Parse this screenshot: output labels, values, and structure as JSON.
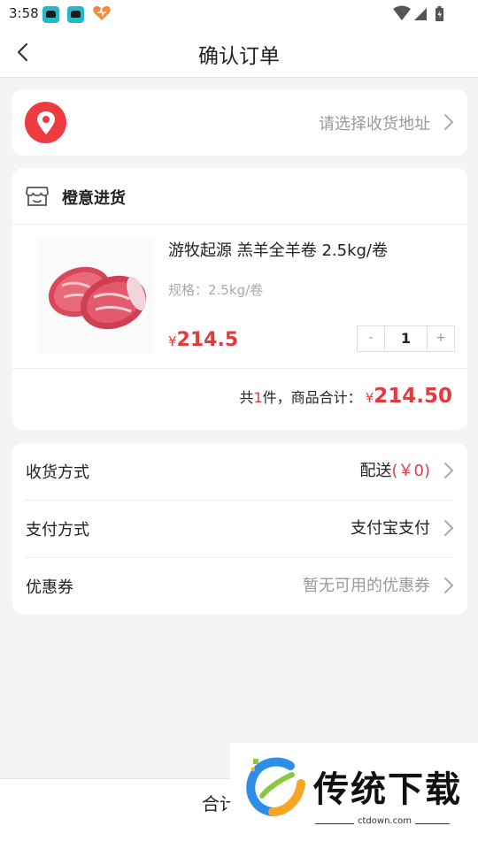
{
  "status_bar": {
    "time": "3:58",
    "icons": [
      "car-app-icon",
      "car-app-icon",
      "heart-app-icon",
      "wifi-icon",
      "signal-icon",
      "battery-icon"
    ]
  },
  "navbar": {
    "title": "确认订单"
  },
  "address": {
    "placeholder": "请选择收货地址"
  },
  "shop": {
    "name": "橙意进货"
  },
  "product": {
    "name": "游牧起源 羔羊全羊卷 2.5kg/卷",
    "spec": "规格：2.5kg/卷",
    "currency": "¥",
    "price": "214.5",
    "quantity": "1",
    "minus": "-",
    "plus": "+"
  },
  "summary": {
    "prefix": "共",
    "count": "1",
    "middle": "件，商品合计：",
    "currency": "¥",
    "total": "214.50"
  },
  "options": {
    "delivery": {
      "label": "收货方式",
      "value": "配送",
      "fee": "(￥0)"
    },
    "payment": {
      "label": "支付方式",
      "value": "支付宝支付"
    },
    "coupon": {
      "label": "优惠券",
      "value": "暂无可用的优惠券"
    }
  },
  "bottom_bar": {
    "total_label": "合计"
  },
  "watermark": {
    "brand": "传统下载",
    "site": "ctdown.com"
  },
  "colors": {
    "accent": "#e33a3f",
    "location_badge": "#ef3a40",
    "background": "#f4f4f4"
  }
}
